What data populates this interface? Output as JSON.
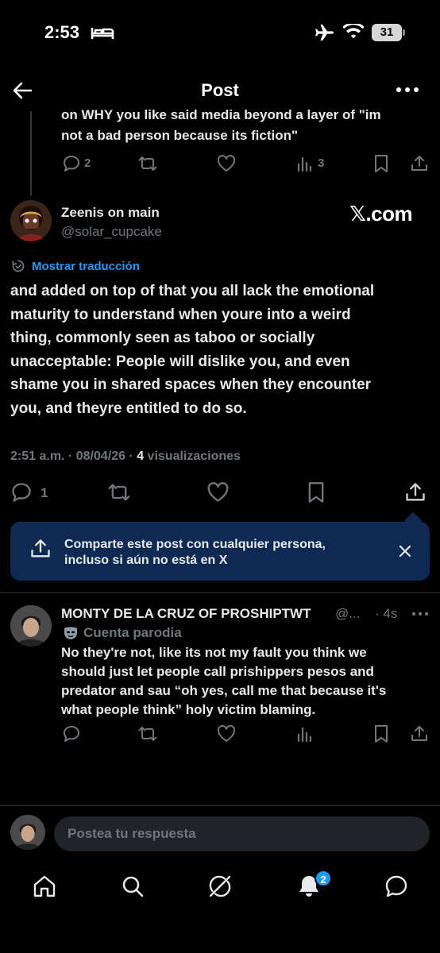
{
  "status_bar": {
    "time": "2:53",
    "battery": "31"
  },
  "header": {
    "title": "Post"
  },
  "parent_post": {
    "text_lines": [
      "on WHY you like said media beyond a layer of \"im",
      "not a bad person because its fiction\""
    ],
    "replies": "2",
    "views": "3"
  },
  "main_post": {
    "author_name": "Zeenis on main",
    "author_handle": "@solar_cupcake",
    "watermark": "𝕏.com",
    "translate_label": "Mostrar traducción",
    "body_lines": [
      "and added on top of that you all lack the emotional",
      "maturity to understand when youre into a weird",
      "thing, commonly seen as taboo or socially",
      "unacceptable: People will dislike you, and even",
      "shame you in shared spaces when they encounter",
      "you, and theyre entitled to do so."
    ],
    "timestamp": "2:51 a.m. · 08/04/26 · ",
    "views_count": "4",
    "views_label": " visualizaciones",
    "replies": "1"
  },
  "share_banner": {
    "lines": [
      "Comparte este post con cualquier persona,",
      "incluso si aún no está en X"
    ]
  },
  "reply": {
    "author_name": "MONTY DE LA CRUZ OF PROSHIPTWT",
    "author_handle": "@...",
    "time": "· 4s",
    "parody_label": "Cuenta parodia",
    "body_lines": [
      "No they're not, like its not my fault you think we",
      "should just let people call prishippers pesos and",
      "predator and sau “oh yes, call me that because it's",
      "what people think” holy victim blaming."
    ]
  },
  "composer": {
    "placeholder": "Postea tu respuesta"
  },
  "tab_bar": {
    "notifications_badge": "2"
  },
  "colors": {
    "accent": "#1d9bf0",
    "background": "#000000",
    "muted": "#71767b",
    "banner": "#0e2a52"
  }
}
